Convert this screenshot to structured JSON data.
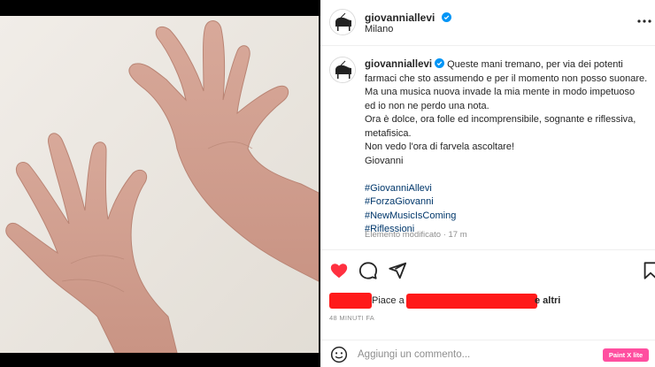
{
  "post": {
    "username": "giovanniallevi",
    "location": "Milano",
    "verified": true
  },
  "caption": {
    "username": "giovanniallevi",
    "first_line": "Queste mani tremano, per via dei potenti",
    "lines": [
      "farmaci che sto assumendo e per il momento non posso suonare.",
      "Ma una musica nuova invade la mia mente in modo impetuoso",
      "ed io non ne perdo una nota.",
      "Ora è dolce, ora folle ed incomprensibile, sognante e riflessiva,",
      "metafisica.",
      "Non vedo l'ora di farvela ascoltare!",
      "Giovanni"
    ],
    "hashtags": [
      "#GiovanniAllevi",
      "#ForzaGiovanni",
      "#NewMusicIsComing",
      "#Riflessioni"
    ],
    "edited": "Elemento modificato · 17 m"
  },
  "likes": {
    "prefix": "Piace a",
    "suffix": "e altri"
  },
  "timestamp": "48 MINUTI FA",
  "comment": {
    "placeholder": "Aggiungi un commento..."
  },
  "badge": "Paint X lite",
  "colors": {
    "like_red": "#ff3040",
    "redaction": "#ff1a1a",
    "hashtag": "#00376b",
    "verified_blue": "#0095f6",
    "badge_pink": "#ff4fa0"
  },
  "icons": [
    "more-icon",
    "heart-icon",
    "comment-icon",
    "share-icon",
    "bookmark-icon",
    "emoji-icon",
    "verified-icon",
    "piano-avatar"
  ]
}
